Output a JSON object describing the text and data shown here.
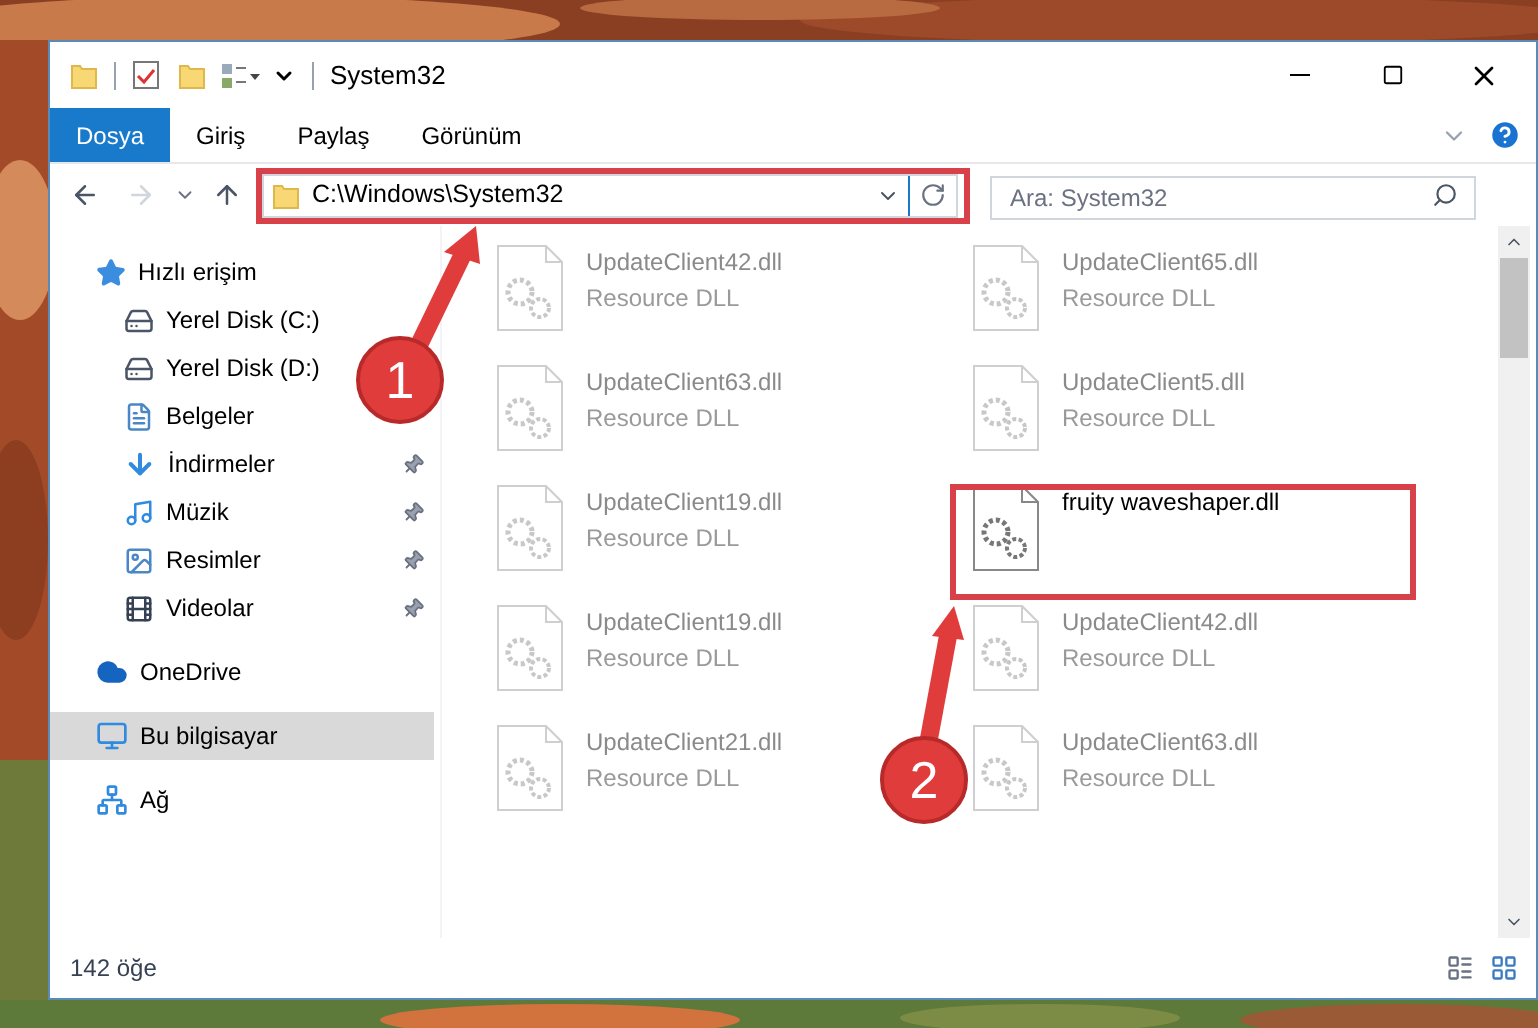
{
  "window": {
    "title": "System32"
  },
  "ribbon": {
    "tabs": [
      {
        "label": "Dosya",
        "kind": "file"
      },
      {
        "label": "Giriş",
        "kind": "tab"
      },
      {
        "label": "Paylaş",
        "kind": "tab"
      },
      {
        "label": "Görünüm",
        "kind": "tab"
      }
    ]
  },
  "address_bar": {
    "path": "C:\\Windows\\System32"
  },
  "search": {
    "placeholder": "Ara: System32"
  },
  "navigation": [
    {
      "label": "Hızlı erişim",
      "kind": "star",
      "selected": false,
      "children": [
        {
          "label": "Yerel Disk (C:)",
          "kind": "drive",
          "pinned": false,
          "selected": false
        },
        {
          "label": "Yerel Disk (D:)",
          "kind": "drive",
          "pinned": false,
          "selected": false
        },
        {
          "label": "Belgeler",
          "kind": "document",
          "pinned": false,
          "selected": false
        },
        {
          "label": "İndirmeler",
          "kind": "download",
          "pinned": true,
          "selected": false
        },
        {
          "label": "Müzik",
          "kind": "music",
          "pinned": true,
          "selected": false
        },
        {
          "label": "Resimler",
          "pinned": true,
          "selected": false
        },
        {
          "label": "Videolar",
          "kind": "video",
          "pinned": true,
          "selected": false
        }
      ]
    },
    {
      "label": "OneDrive",
      "kind": "cloud",
      "selected": false
    },
    {
      "label": "Bu bilgisayar",
      "kind": "computer",
      "selected": true
    },
    {
      "label": "Ağ",
      "kind": "network",
      "selected": false
    }
  ],
  "files": [
    {
      "name": "UpdateClient42.dll",
      "type": "Resource DLL",
      "faded": true
    },
    {
      "name": "UpdateClient65.dll",
      "type": "Resource DLL",
      "faded": true
    },
    {
      "name": "UpdateClient63.dll",
      "type": "Resource DLL",
      "faded": true
    },
    {
      "name": "UpdateClient5.dll",
      "type": "Resource DLL",
      "faded": true
    },
    {
      "name": "UpdateClient19.dll",
      "type": "Resource DLL",
      "faded": true
    },
    {
      "name": "fruity waveshaper.dll",
      "faded": false
    },
    {
      "name": "UpdateClient19.dll",
      "type": "Resource DLL",
      "faded": true
    },
    {
      "name": "UpdateClient42.dll",
      "type": "Resource DLL",
      "faded": true
    },
    {
      "name": "UpdateClient21.dll",
      "type": "Resource DLL",
      "faded": true
    },
    {
      "name": "UpdateClient63.dll",
      "type": "Resource DLL",
      "faded": true
    }
  ],
  "annotations": [
    {
      "number": "1"
    },
    {
      "number": "2"
    }
  ],
  "status_bar": {
    "item_count": "142 öğe"
  }
}
